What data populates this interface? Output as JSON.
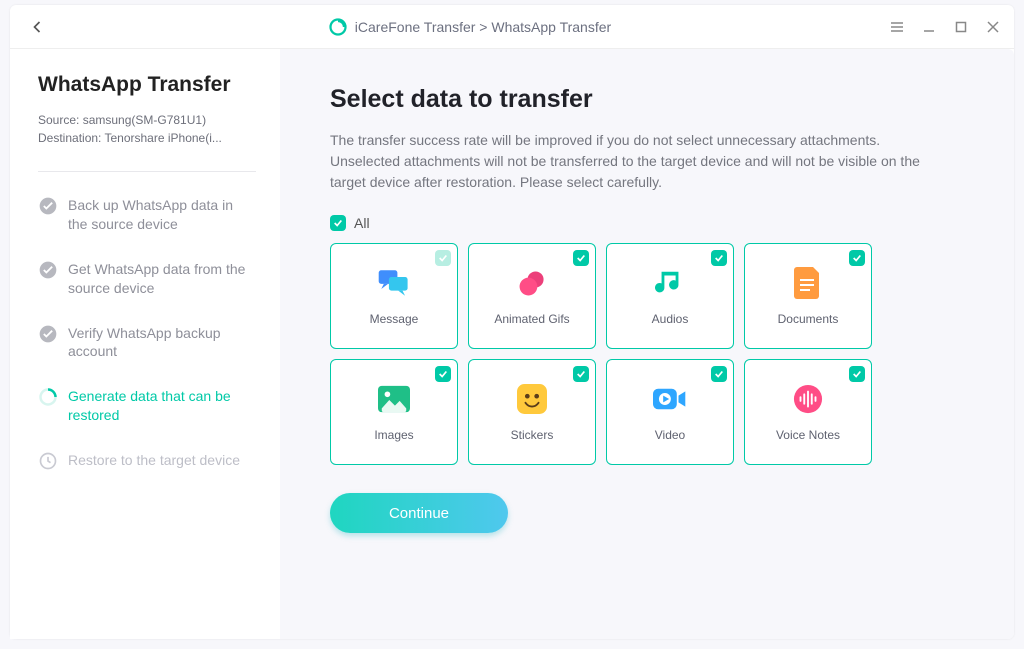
{
  "titlebar": {
    "title_text": "iCareFone Transfer > WhatsApp Transfer"
  },
  "sidebar": {
    "title": "WhatsApp Transfer",
    "source_line": "Source: samsung(SM-G781U1)",
    "dest_line": "Destination: Tenorshare iPhone(i...",
    "steps": [
      {
        "label": "Back up WhatsApp data in the source device",
        "state": "done"
      },
      {
        "label": "Get WhatsApp data from the source device",
        "state": "done"
      },
      {
        "label": "Verify WhatsApp backup account",
        "state": "done"
      },
      {
        "label": "Generate data that can be restored",
        "state": "active"
      },
      {
        "label": "Restore to the target device",
        "state": "pending"
      }
    ]
  },
  "main": {
    "heading": "Select data to transfer",
    "description": "The transfer success rate will be improved if you do not select unnecessary attachments. Unselected attachments will not be transferred to the target device and will not be visible on the target device after restoration. Please select carefully.",
    "all_label": "All",
    "cards": [
      {
        "label": "Message",
        "icon": "message",
        "checked": true
      },
      {
        "label": "Animated Gifs",
        "icon": "gif",
        "checked": true
      },
      {
        "label": "Audios",
        "icon": "audio",
        "checked": true
      },
      {
        "label": "Documents",
        "icon": "document",
        "checked": true
      },
      {
        "label": "Images",
        "icon": "image",
        "checked": true
      },
      {
        "label": "Stickers",
        "icon": "sticker",
        "checked": true
      },
      {
        "label": "Video",
        "icon": "video",
        "checked": true
      },
      {
        "label": "Voice Notes",
        "icon": "voice",
        "checked": true
      }
    ],
    "continue_label": "Continue"
  },
  "colors": {
    "accent": "#00c9a7"
  }
}
